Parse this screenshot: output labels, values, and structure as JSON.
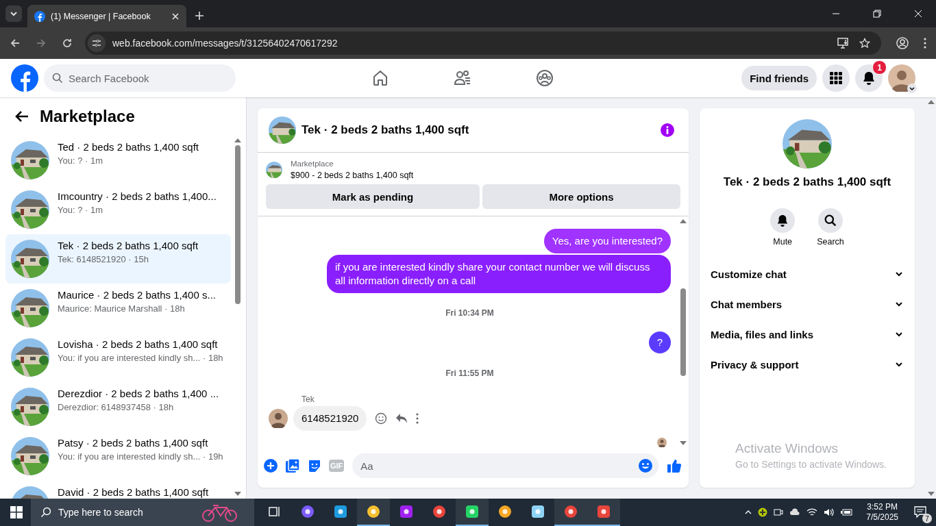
{
  "browser": {
    "tabs": [
      {
        "title": "(1) Messenger | Facebook",
        "selected": true
      }
    ],
    "url": "web.facebook.com/messages/t/31256402470617292"
  },
  "header": {
    "search": {
      "placeholder": "Search Facebook"
    },
    "find_friends": "Find friends",
    "notification_count": "1"
  },
  "sidebar": {
    "title": "Marketplace",
    "conversations": [
      {
        "title": "Ted · 2 beds 2 baths 1,400 sqft",
        "preview": "You: ? · 1m",
        "selected": false
      },
      {
        "title": "Imcountry · 2 beds 2 baths 1,400...",
        "preview": "You: ? · 1m",
        "selected": false
      },
      {
        "title": "Tek · 2 beds 2 baths 1,400 sqft",
        "preview": "Tek: 6148521920 · 15h",
        "selected": true
      },
      {
        "title": "Maurice · 2 beds 2 baths 1,400 s...",
        "preview": "Maurice: Maurice Marshall · 18h",
        "selected": false
      },
      {
        "title": "Lovisha · 2 beds 2 baths 1,400 sqft",
        "preview": "You: if you are interested kindly sh... · 18h",
        "selected": false
      },
      {
        "title": "Derezdior · 2 beds 2 baths 1,400 ...",
        "preview": "Derezdior: 6148937458 · 18h",
        "selected": false
      },
      {
        "title": "Patsy · 2 beds 2 baths 1,400 sqft",
        "preview": "You: if you are interested kindly sh... · 19h",
        "selected": false
      },
      {
        "title": "David · 2 beds 2 baths 1,400 sqft",
        "selected": false
      }
    ]
  },
  "chat": {
    "title": "Tek · 2 beds 2 baths 1,400 sqft",
    "listing": {
      "label": "Marketplace",
      "title": "$900 - 2 beds 2 baths 1,400 sqft"
    },
    "buttons": [
      "Mark as pending",
      "More options"
    ],
    "messages": [
      {
        "kind": "sent",
        "text": "Yes, are you interested?",
        "color": "#a033ff"
      },
      {
        "kind": "sent",
        "text": "if you are interested kindly share your contact number we will discuss all information directly on a call",
        "color": "#8a1ffd"
      },
      {
        "kind": "time",
        "text": "Fri 10:34 PM"
      },
      {
        "kind": "sent",
        "text": "?",
        "color": "#5b3cff"
      },
      {
        "kind": "time",
        "text": "Fri 11:55 PM"
      },
      {
        "kind": "received",
        "sender": "Tek",
        "text": "6148521920"
      }
    ],
    "composer": {
      "placeholder": "Aa",
      "gif": "GIF"
    }
  },
  "details": {
    "name": "Tek · 2 beds 2 baths 1,400 sqft",
    "actions": [
      "Mute",
      "Search"
    ],
    "sections": [
      {
        "label": "Customize chat",
        "expanded": false
      },
      {
        "label": "Chat members",
        "expanded": false
      },
      {
        "label": "Media, files and links",
        "expanded": false
      },
      {
        "label": "Privacy & support",
        "expanded": false
      }
    ]
  },
  "activation": {
    "title": "Activate Windows",
    "subtitle": "Go to Settings to activate Windows."
  },
  "taskbar": {
    "search": {
      "placeholder": "Type here to search"
    },
    "apps": [
      {
        "open": false
      },
      {
        "open": false
      },
      {
        "open": false
      },
      {
        "open": true
      },
      {
        "open": false
      },
      {
        "open": false
      },
      {
        "open": true
      },
      {
        "open": false
      },
      {
        "open": false
      },
      {
        "open": true
      },
      {
        "open": true
      }
    ],
    "time": "3:52 PM",
    "date": "7/5/2025",
    "notification_count": "7"
  }
}
